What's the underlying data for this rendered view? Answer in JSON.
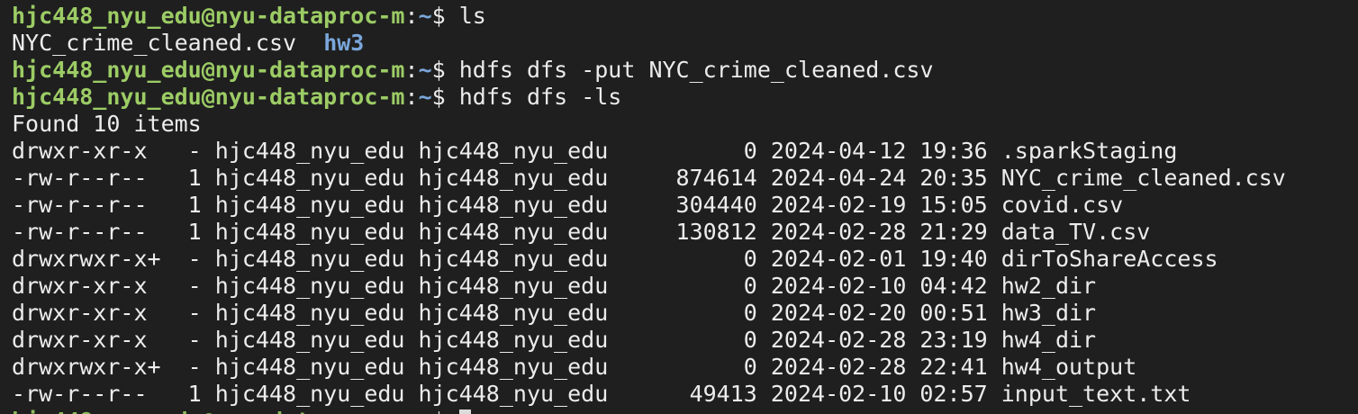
{
  "prompt": {
    "user_host": "hjc448_nyu_edu@nyu-dataproc-m",
    "colon": ":",
    "path": "~",
    "dollar": "$ "
  },
  "commands": [
    "ls",
    "hdfs dfs -put NYC_crime_cleaned.csv",
    "hdfs dfs -ls"
  ],
  "ls_output": {
    "file": "NYC_crime_cleaned.csv",
    "spacer": "  ",
    "dir": "hw3"
  },
  "found_line": "Found 10 items",
  "hdfs_rows": [
    "drwxr-xr-x   - hjc448_nyu_edu hjc448_nyu_edu          0 2024-04-12 19:36 .sparkStaging",
    "-rw-r--r--   1 hjc448_nyu_edu hjc448_nyu_edu     874614 2024-04-24 20:35 NYC_crime_cleaned.csv",
    "-rw-r--r--   1 hjc448_nyu_edu hjc448_nyu_edu     304440 2024-02-19 15:05 covid.csv",
    "-rw-r--r--   1 hjc448_nyu_edu hjc448_nyu_edu     130812 2024-02-28 21:29 data_TV.csv",
    "drwxrwxr-x+  - hjc448_nyu_edu hjc448_nyu_edu          0 2024-02-01 19:40 dirToShareAccess",
    "drwxr-xr-x   - hjc448_nyu_edu hjc448_nyu_edu          0 2024-02-10 04:42 hw2_dir",
    "drwxr-xr-x   - hjc448_nyu_edu hjc448_nyu_edu          0 2024-02-20 00:51 hw3_dir",
    "drwxr-xr-x   - hjc448_nyu_edu hjc448_nyu_edu          0 2024-02-28 23:19 hw4_dir",
    "drwxrwxr-x+  - hjc448_nyu_edu hjc448_nyu_edu          0 2024-02-28 22:41 hw4_output",
    "-rw-r--r--   1 hjc448_nyu_edu hjc448_nyu_edu      49413 2024-02-10 02:57 input_text.txt"
  ]
}
